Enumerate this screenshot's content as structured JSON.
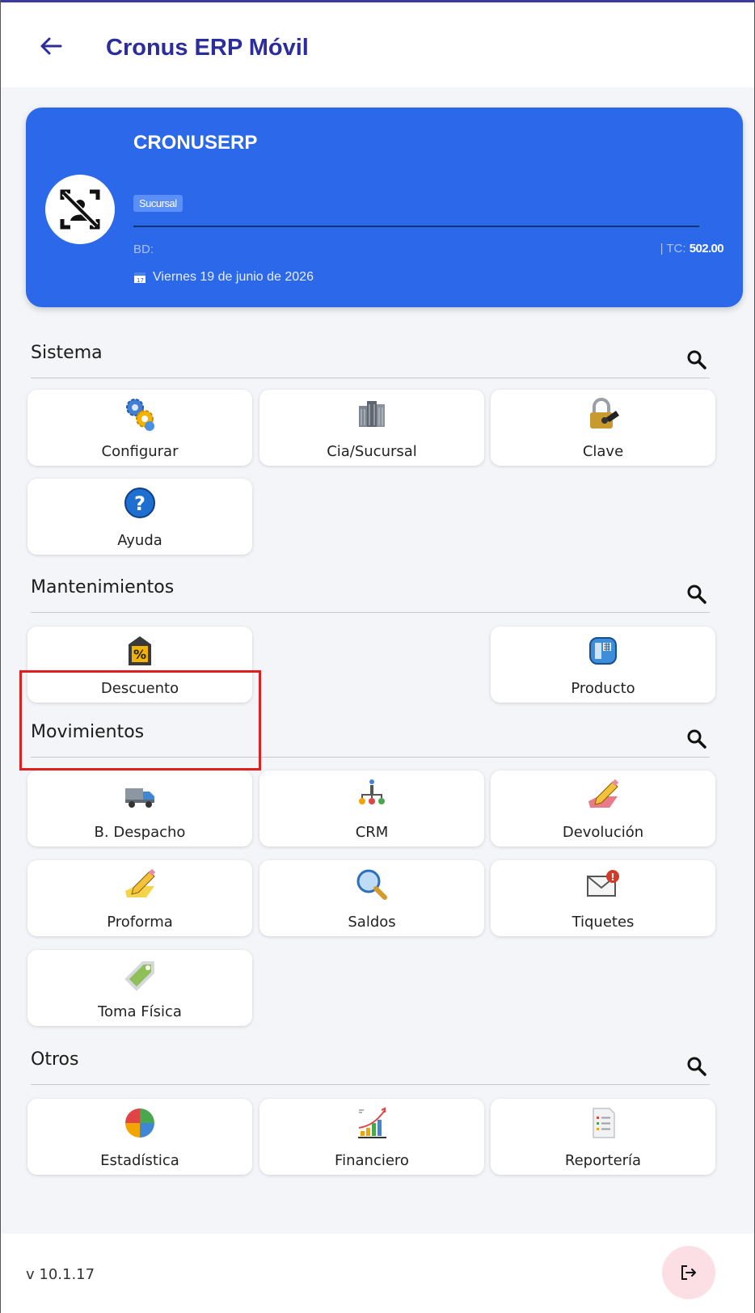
{
  "header": {
    "title": "Cronus ERP Móvil"
  },
  "profile": {
    "company": "CRONUSERP",
    "branch_badge": "Sucursal",
    "bd_label": "BD:",
    "tc_label": "| TC:",
    "tc_value": "502.00",
    "date": "Viernes 19 de junio de 2026"
  },
  "sections": {
    "sistema": {
      "title": "Sistema",
      "items": [
        "Configurar",
        "Cia/Sucursal",
        "Clave",
        "Ayuda"
      ]
    },
    "mantenimientos": {
      "title": "Mantenimientos",
      "items": [
        "Descuento",
        "Producto"
      ]
    },
    "movimientos": {
      "title": "Movimientos",
      "items": [
        "B. Despacho",
        "CRM",
        "Devolución",
        "Proforma",
        "Saldos",
        "Tiquetes",
        "Toma Física"
      ]
    },
    "otros": {
      "title": "Otros",
      "items": [
        "Estadística",
        "Financiero",
        "Reportería"
      ]
    }
  },
  "footer": {
    "version": "v 10.1.17"
  },
  "colors": {
    "primary": "#2c68ea",
    "title": "#2b2d9c",
    "highlight": "#e02020",
    "logout_bg": "#fbdfe4"
  }
}
